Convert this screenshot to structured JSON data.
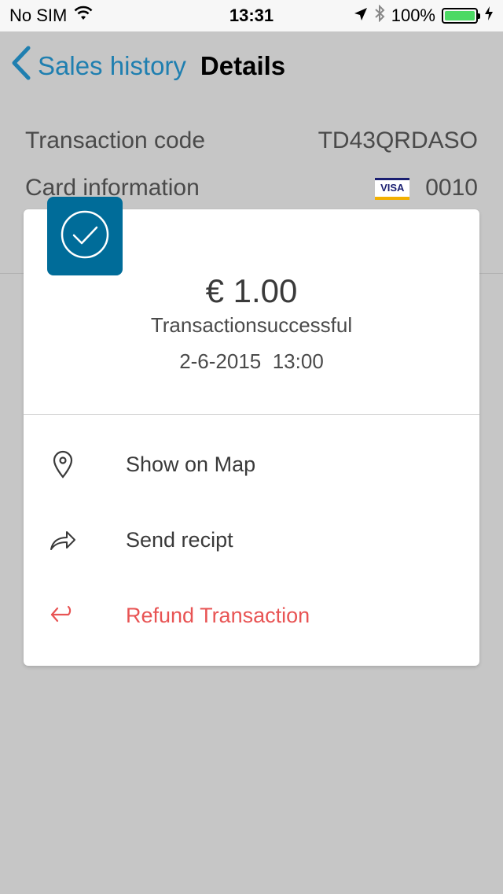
{
  "status_bar": {
    "carrier": "No SIM",
    "time": "13:31",
    "battery": "100%",
    "battery_level": 1.0
  },
  "nav": {
    "back_label": "Sales history",
    "title": "Details"
  },
  "details": {
    "transaction_code_label": "Transaction code",
    "transaction_code_value": "TD43QRDASO",
    "card_info_label": "Card information",
    "card_brand": "VISA",
    "card_last4": "0010"
  },
  "card": {
    "amount": "€ 1.00",
    "status": "Transactionsuccessful",
    "date": "2-6-2015",
    "time": "13:00",
    "actions": [
      {
        "label": "Show on Map",
        "icon": "map-pin-icon"
      },
      {
        "label": "Send recipt",
        "icon": "share-arrow-icon"
      },
      {
        "label": "Refund Transaction",
        "icon": "refund-arrow-icon"
      }
    ]
  },
  "colors": {
    "accent": "#1f7fb0",
    "badge": "#006c99",
    "danger": "#e85454",
    "overlay_bg": "#c6c6c6"
  }
}
